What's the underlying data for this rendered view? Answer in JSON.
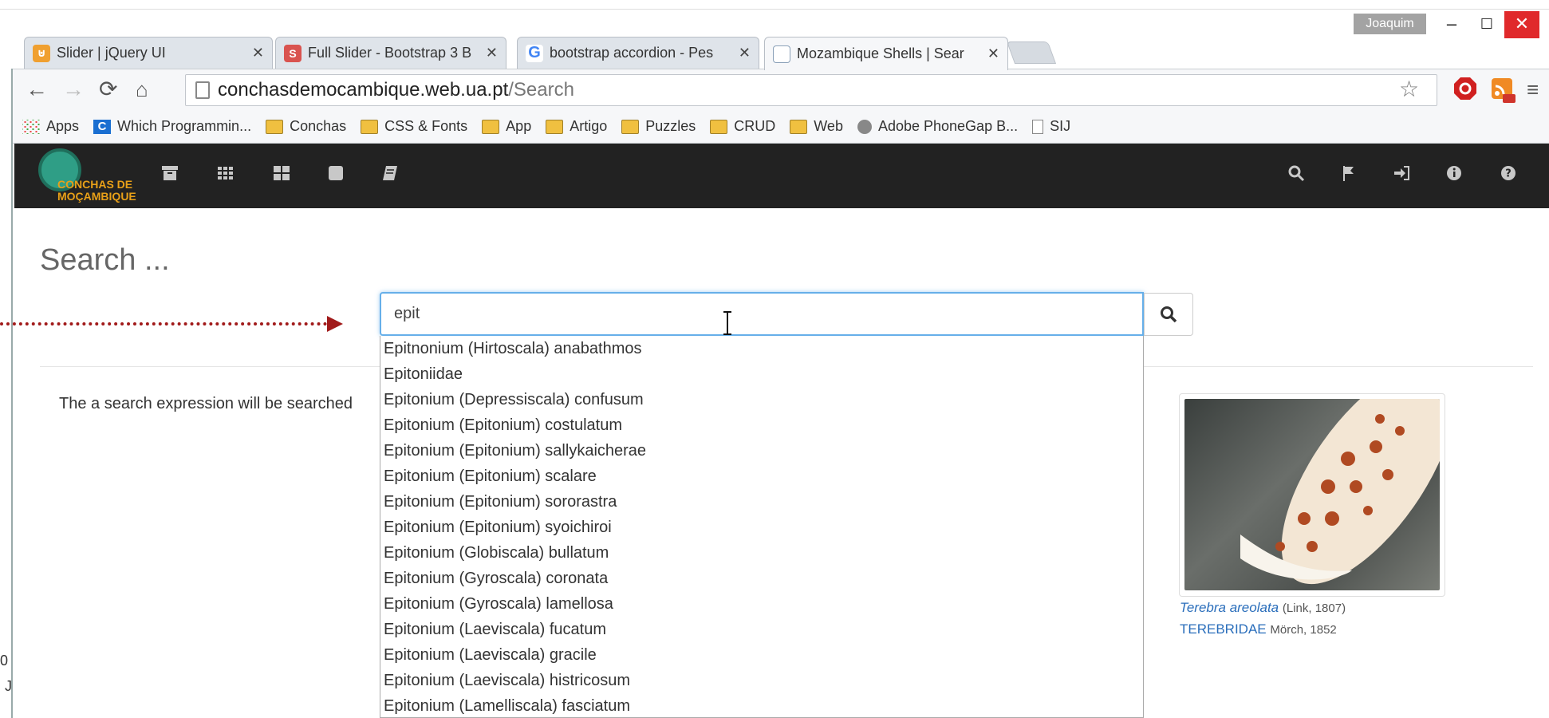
{
  "window": {
    "user": "Joaquim",
    "controls": {
      "minimize": "–",
      "maximize": "☐",
      "close": "✕"
    }
  },
  "tabs": [
    {
      "title": "Slider | jQuery UI",
      "icon": "jquery-icon",
      "color": "#f0a030"
    },
    {
      "title": "Full Slider - Bootstrap 3 B",
      "icon": "s-icon",
      "color": "#d9534f"
    },
    {
      "title": "bootstrap accordion - Pes",
      "icon": "google-icon",
      "color": "#4285f4"
    },
    {
      "title": "Mozambique Shells | Sear",
      "icon": "page-icon",
      "color": "#8aa0b8"
    }
  ],
  "address": {
    "host": "conchasdemocambique.web.ua.pt",
    "path": "/Search"
  },
  "bookmarks": [
    {
      "label": "Apps",
      "type": "apps"
    },
    {
      "label": "Which Programmin...",
      "type": "c"
    },
    {
      "label": "Conchas",
      "type": "folder"
    },
    {
      "label": "CSS & Fonts",
      "type": "folder"
    },
    {
      "label": "App",
      "type": "folder"
    },
    {
      "label": "Artigo",
      "type": "folder"
    },
    {
      "label": "Puzzles",
      "type": "folder"
    },
    {
      "label": "CRUD",
      "type": "folder"
    },
    {
      "label": "Web",
      "type": "folder"
    },
    {
      "label": "Adobe PhoneGap B...",
      "type": "phonegap"
    },
    {
      "label": "SIJ",
      "type": "page"
    }
  ],
  "site": {
    "logo_line1": "CONCHAS DE",
    "logo_line2": "MOÇAMBIQUE",
    "nav_left": [
      "archive-icon",
      "grid-icon",
      "tiles-icon",
      "square-icon",
      "book-icon"
    ],
    "nav_right": [
      "search-icon",
      "flag-icon",
      "login-icon",
      "info-icon",
      "help-icon"
    ]
  },
  "main": {
    "heading": "Search ...",
    "query": "epit",
    "description": "The a search expression will be searched",
    "suggestions": [
      "Epitnonium (Hirtoscala) anabathmos",
      "Epitoniidae",
      "Epitonium (Depressiscala) confusum",
      "Epitonium (Epitonium) costulatum",
      "Epitonium (Epitonium) sallykaicherae",
      "Epitonium (Epitonium) scalare",
      "Epitonium (Epitonium) sororastra",
      "Epitonium (Epitonium) syoichiroi",
      "Epitonium (Globiscala) bullatum",
      "Epitonium (Gyroscala) coronata",
      "Epitonium (Gyroscala) lamellosa",
      "Epitonium (Laeviscala) fucatum",
      "Epitonium (Laeviscala) gracile",
      "Epitonium (Laeviscala) histricosum",
      "Epitonium (Lamelliscala) fasciatum"
    ],
    "featured": {
      "species": "Terebra areolata",
      "species_author": "(Link, 1807)",
      "family": "TEREBRIDAE",
      "family_author": "Mörch, 1852"
    },
    "left_stub1": "0",
    "left_stub2": "J"
  },
  "colors": {
    "accent": "#66afe9",
    "link": "#2a6ebb",
    "arrow": "#a11a1a",
    "nav_bg": "#222222"
  }
}
